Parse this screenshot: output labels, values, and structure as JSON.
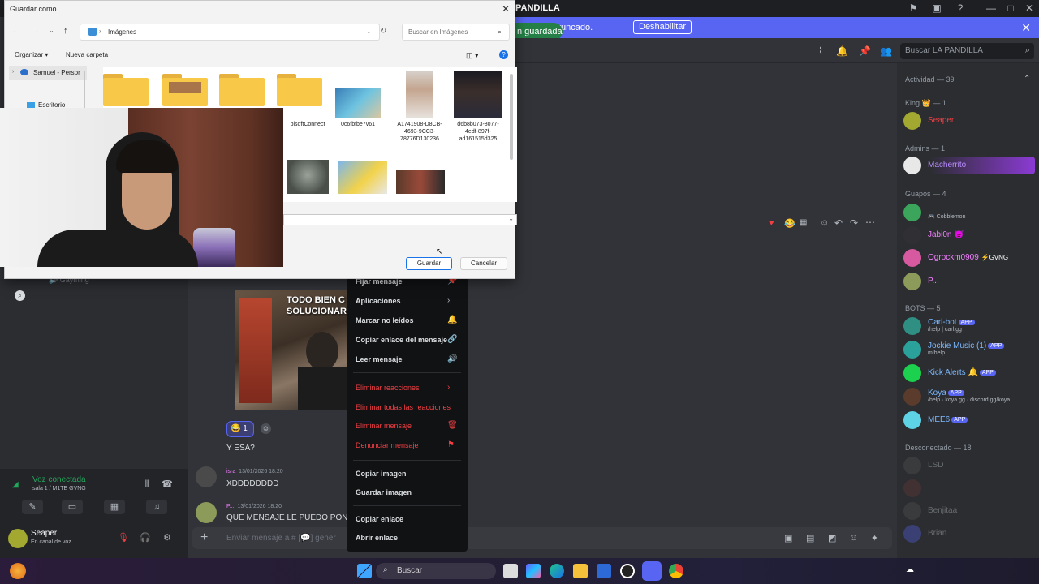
{
  "discord": {
    "window_title": "PANDILLA",
    "banner": {
      "text": "o se han truncado.",
      "button": "Deshabilitar"
    },
    "saved_toast": "n guardada",
    "search_placeholder": "Buscar LA PANDILLA",
    "members": {
      "activity_header": "Actividad — 39",
      "king_header": "King 👑 — 1",
      "king": [
        {
          "name": "Seaper",
          "color": "#f23f43"
        }
      ],
      "admins_header": "Admins — 1",
      "admins": [
        {
          "name": "Macherrito",
          "color": "#b98cff"
        }
      ],
      "guapos_header": "Guapos — 4",
      "guapos": [
        {
          "name": "",
          "sub": "Cobblemon"
        },
        {
          "name": "Jabi0n 👿",
          "color": "#f47fff"
        },
        {
          "name": "Ogrockm0909",
          "suffix": "GVNG",
          "color": "#f47fff"
        },
        {
          "name": "P...",
          "color": "#f47fff"
        }
      ],
      "bots_header": "BOTS — 5",
      "bots": [
        {
          "name": "Carl-bot",
          "tag": "APP",
          "sub": "/help | carl.gg",
          "color": "#7db9ff"
        },
        {
          "name": "Jockie Music (1)",
          "tag": "APP",
          "sub": "m!help",
          "color": "#7db9ff"
        },
        {
          "name": "Kick Alerts",
          "tag": "APP",
          "sub": "",
          "color": "#7db9ff"
        },
        {
          "name": "Koya",
          "tag": "APP",
          "sub": "/help · koya.gg · discord.gg/koya",
          "color": "#7db9ff"
        },
        {
          "name": "MEE6",
          "tag": "APP",
          "sub": "",
          "color": "#7db9ff"
        }
      ],
      "offline_header": "Desconectado — 18",
      "offline": [
        "LSD",
        "",
        "Benjitaa",
        "Brian",
        ""
      ]
    },
    "voice": {
      "status": "Voz conectada",
      "channel": "sala 1 / M1TE GVNG"
    },
    "user": {
      "name": "Seaper",
      "status": "En canal de voz"
    },
    "channel_item": "Gayming",
    "image_caption": "TODO BIEN C SOLUCIONAR",
    "reaction_count": "1",
    "messages": [
      {
        "text": "Y ESA?"
      },
      {
        "author": "isra",
        "time": "13/01/2026 18:20",
        "text": "XDDDDDDDD"
      },
      {
        "author": "P...",
        "time": "13/01/2026 18:20",
        "text": "QUE MENSAJE LE PUEDO PONE"
      }
    ],
    "composer_placeholder": "Enviar mensaje a # [💬] gener",
    "context_menu": {
      "items": [
        {
          "label": "Fijar mensaje",
          "icon": "📌"
        },
        {
          "label": "Aplicaciones",
          "icon": "›"
        },
        {
          "label": "Marcar no leídos",
          "icon": "🔔"
        },
        {
          "label": "Copiar enlace del mensaje",
          "icon": "🔗"
        },
        {
          "label": "Leer mensaje",
          "icon": "🔊"
        },
        {
          "label": "Eliminar reacciones",
          "icon": "›"
        },
        {
          "label": "Eliminar todas las reacciones",
          "icon": ""
        },
        {
          "label": "Eliminar mensaje",
          "icon": "🗑"
        },
        {
          "label": "Denunciar mensaje",
          "icon": "⚑"
        },
        {
          "label": "Copiar imagen",
          "icon": ""
        },
        {
          "label": "Guardar imagen",
          "icon": ""
        },
        {
          "label": "Copiar enlace",
          "icon": ""
        },
        {
          "label": "Abrir enlace",
          "icon": ""
        }
      ]
    }
  },
  "save_dialog": {
    "title": "Guardar como",
    "address": "Imágenes",
    "search_placeholder": "Buscar en Imágenes",
    "toolbar": {
      "organize": "Organizar",
      "new_folder": "Nueva carpeta"
    },
    "nav": {
      "samuel": "Samuel - Persor",
      "desktop": "Escritorio"
    },
    "files": [
      {
        "name": ""
      },
      {
        "name": ""
      },
      {
        "name": ""
      },
      {
        "name": "bisoftConnect"
      },
      {
        "name": "0c6fbfbe7v61"
      },
      {
        "name": "A1741908-D8CB-4693-9CC3-78776D130236"
      },
      {
        "name": "d6b8b073-8077-4edf-897f-ad161515d325"
      }
    ],
    "save_label": "Guardar",
    "cancel_label": "Cancelar"
  },
  "taskbar": {
    "search_label": "Buscar"
  },
  "colors": {
    "discord_bg": "#313338",
    "blurple": "#5865f2",
    "danger": "#f23f43",
    "online": "#23a55a"
  }
}
